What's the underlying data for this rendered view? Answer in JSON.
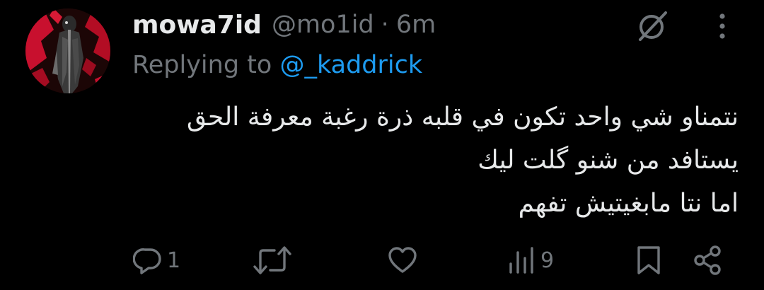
{
  "tweet": {
    "display_name": "mowa7id",
    "handle": "@mo1id",
    "separator": "·",
    "time": "6m",
    "replying_prefix": "Replying to",
    "replying_handle": "@_kaddrick",
    "body_lines": [
      "نتمناو شي واحد تكون في قلبه ذرة رغبة معرفة الحق",
      "يستافد من شنو گلت ليك",
      "اما نتا مابغيتيش تفهم"
    ]
  },
  "actions": {
    "reply_count": "1",
    "repost_count": "",
    "like_count": "",
    "views_count": "9"
  },
  "icons": {
    "header": [
      "grok-icon",
      "more-options-icon"
    ],
    "actions": [
      "reply-icon",
      "repost-icon",
      "like-icon",
      "views-icon",
      "bookmark-icon",
      "share-icon"
    ]
  },
  "colors": {
    "background": "#000000",
    "primary_text": "#e7e9ea",
    "secondary_text": "#71767b",
    "link": "#1d9bf0"
  }
}
